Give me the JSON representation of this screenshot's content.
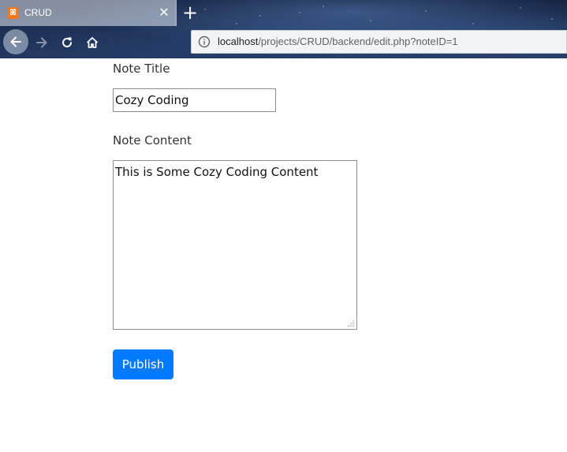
{
  "browser": {
    "tab": {
      "title": "CRUD",
      "favicon_glyph": "ꕤ",
      "favicon_color": "#f37721"
    },
    "new_tab_glyph": "+",
    "close_glyph": "✕",
    "address_bar": {
      "host": "localhost",
      "path": "/projects/CRUD/backend/edit.php?noteID=1"
    },
    "icons": [
      "back-icon",
      "forward-icon",
      "reload-icon",
      "home-icon",
      "info-icon"
    ]
  },
  "form": {
    "title_label": "Note Title",
    "title_value": "Cozy Coding",
    "content_label": "Note Content",
    "content_value": "This is Some Cozy Coding Content",
    "publish_label": "Publish",
    "accent_color": "#007bff"
  }
}
